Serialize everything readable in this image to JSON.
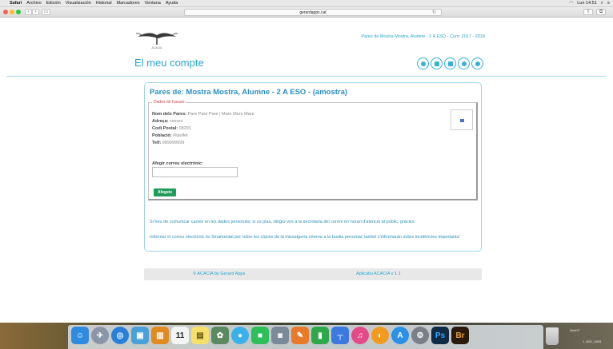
{
  "menubar": {
    "items": [
      "Safari",
      "Archivo",
      "Edición",
      "Visualización",
      "Historial",
      "Marcadores",
      "Ventana",
      "Ayuda"
    ],
    "clock": "Lun 14:51",
    "search_glyph": "⌕",
    "list_glyph": "≡"
  },
  "toolbar": {
    "url": "gerardapps.cat",
    "back": "‹",
    "forward": "›",
    "reload": "↻"
  },
  "header": {
    "logo_text": "ACACIA",
    "info": "Pares de Mostra Mostra, Alumne - 2 A ESO - Curs: 2017 - 2018",
    "account_title": "El meu compte",
    "nav_icons": [
      "home-icon",
      "mail-icon",
      "calendar-icon",
      "user-icon",
      "logout-icon"
    ]
  },
  "card": {
    "title": "Pares de: Mostra Mostra, Alumne - 2 A ESO - (amostra)",
    "legend": "Dades de l'usuari",
    "fields": [
      {
        "label": "Nom dels Pares:",
        "value": "Pare Pare Pare  |  Mare Mare Mare"
      },
      {
        "label": "Adreça:",
        "value": "xxxxxx"
      },
      {
        "label": "Codi Postal:",
        "value": "08291"
      },
      {
        "label": "Població:",
        "value": "Ripollet"
      },
      {
        "label": "Telf:",
        "value": "999999999"
      }
    ],
    "add_email_label": "Afegir correu electrònic:",
    "email_value": "",
    "add_button": "Afegeix",
    "note1": "Si heu de comunicar canvis en les dades personals, si us plau, dirigiu-vos a la secretaria del centre en horari d'atenció al públic, gràcies.",
    "note2": "Informar el correu electrònic és fonamental per rebre les còpies de la missatgeria interna a la bustia personal, també s'informaràn sobre incidències importants!"
  },
  "footer": {
    "left": "© ACACIA by Gerard Apps",
    "right": "Aplicatiu ACACIA v 1.1"
  },
  "dock": {
    "apps": [
      {
        "name": "finder",
        "bg": "#2f8be0",
        "glyph": "☺"
      },
      {
        "name": "launchpad",
        "bg": "#8a96a8",
        "glyph": "✈"
      },
      {
        "name": "safari",
        "bg": "#2a7fd8",
        "glyph": "◎"
      },
      {
        "name": "preview",
        "bg": "#4aa0d8",
        "glyph": "▣"
      },
      {
        "name": "books",
        "bg": "#e08a20",
        "glyph": "▥"
      },
      {
        "name": "calendar",
        "bg": "#f4f4f4",
        "glyph": "11"
      },
      {
        "name": "notes",
        "bg": "#f6e06a",
        "glyph": "▤"
      },
      {
        "name": "photos-app",
        "bg": "#5a8a60",
        "glyph": "✿"
      },
      {
        "name": "messages",
        "bg": "#3ab0e8",
        "glyph": "●"
      },
      {
        "name": "facetime",
        "bg": "#2fbf5a",
        "glyph": "■"
      },
      {
        "name": "image-capture",
        "bg": "#7a8a9a",
        "glyph": "◙"
      },
      {
        "name": "pages",
        "bg": "#e87a2a",
        "glyph": "✎"
      },
      {
        "name": "numbers",
        "bg": "#2fa84a",
        "glyph": "▮"
      },
      {
        "name": "keynote",
        "bg": "#3a7ae0",
        "glyph": "┬"
      },
      {
        "name": "itunes",
        "bg": "#e24a8a",
        "glyph": "♫"
      },
      {
        "name": "ibooks",
        "bg": "#f29a20",
        "glyph": "◐"
      },
      {
        "name": "app-store",
        "bg": "#2a90e8",
        "glyph": "A"
      },
      {
        "name": "system-preferences",
        "bg": "#7a7f88",
        "glyph": "⚙"
      },
      {
        "name": "photoshop",
        "bg": "#0f2a44",
        "glyph": "Ps"
      },
      {
        "name": "bridge",
        "bg": "#2a1a0a",
        "glyph": "Br"
      }
    ],
    "desktop_label": "Abril17",
    "desktop_file": "1_IMG_0403"
  },
  "colors": {
    "accent": "#2aa4d0",
    "button_green": "#1f9b5a",
    "link_blue": "#2e8fbd"
  }
}
